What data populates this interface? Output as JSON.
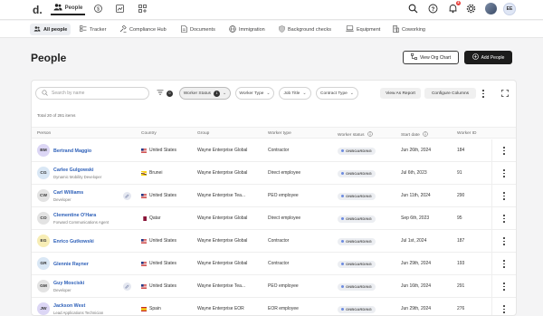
{
  "app": {
    "logo": "d.",
    "nav": [
      {
        "label": "People",
        "icon": "people-icon"
      },
      {
        "label": "",
        "icon": "dollar-icon"
      },
      {
        "label": "",
        "icon": "report-icon"
      },
      {
        "label": "",
        "icon": "grid-icon"
      }
    ],
    "notifications_count": "8",
    "user_initials": "EE"
  },
  "subnav": [
    {
      "label": "All people",
      "icon": "people-icon"
    },
    {
      "label": "Tracker",
      "icon": "tracker-icon"
    },
    {
      "label": "Compliance Hub",
      "icon": "gavel-icon"
    },
    {
      "label": "Documents",
      "icon": "document-icon"
    },
    {
      "label": "Immigration",
      "icon": "globe-icon"
    },
    {
      "label": "Background checks",
      "icon": "shield-icon"
    },
    {
      "label": "Equipment",
      "icon": "laptop-icon"
    },
    {
      "label": "Coworking",
      "icon": "building-icon"
    }
  ],
  "page": {
    "title": "People",
    "view_org_chart": "View Org Chart",
    "add_people": "Add People"
  },
  "toolbar": {
    "search_placeholder": "Search by name",
    "filter_count": "0",
    "filters": [
      {
        "label": "Worker Status",
        "count": "1"
      },
      {
        "label": "Worker Type"
      },
      {
        "label": "Job Title"
      },
      {
        "label": "Contract Type"
      }
    ],
    "view_as_report": "View As Report",
    "configure_columns": "Configure Columns"
  },
  "table": {
    "total_label": "Total 20 of 281 items",
    "columns": [
      "Person",
      "Country",
      "Group",
      "Worker type",
      "Worker status",
      "Start date",
      "Worker ID"
    ],
    "rows": [
      {
        "initials": "BM",
        "avatar_color": "#dcd6f5",
        "name": "Bertrand Maggio",
        "title": "",
        "country": "United States",
        "flag": "us",
        "group": "Wayne Enterprise Global",
        "type": "Contractor",
        "status": "ONBOARDING",
        "start": "Jun 26th, 2024",
        "id": "184",
        "edit": false
      },
      {
        "initials": "CG",
        "avatar_color": "#d9e7f5",
        "name": "Carlee Gulgowski",
        "title": "Dynamic Mobility Developer",
        "country": "Brunei",
        "flag": "bn",
        "group": "Wayne Enterprise Global",
        "type": "Direct employee",
        "status": "ONBOARDING",
        "start": "Jul 6th, 2023",
        "id": "91",
        "edit": false
      },
      {
        "initials": "CW",
        "avatar_color": "#e3e3e3",
        "name": "Carl Williams",
        "title": "Developer",
        "country": "United States",
        "flag": "us",
        "group": "Wayne Enterprise Tea...",
        "type": "PEO employee",
        "status": "ONBOARDING",
        "start": "Jun 11th, 2024",
        "id": "290",
        "edit": true
      },
      {
        "initials": "CO",
        "avatar_color": "#e3e3e3",
        "name": "Clementine O'Hara",
        "title": "Forward Communications Agent",
        "country": "Qatar",
        "flag": "qa",
        "group": "Wayne Enterprise Global",
        "type": "Direct employee",
        "status": "ONBOARDING",
        "start": "Sep 6th, 2023",
        "id": "95",
        "edit": false
      },
      {
        "initials": "EG",
        "avatar_color": "#f7edb5",
        "name": "Enrico Gutkowski",
        "title": "",
        "country": "United States",
        "flag": "us",
        "group": "Wayne Enterprise Global",
        "type": "Contractor",
        "status": "ONBOARDING",
        "start": "Jul 1st, 2024",
        "id": "187",
        "edit": false
      },
      {
        "initials": "GR",
        "avatar_color": "#d9e7f5",
        "name": "Glennie Rayner",
        "title": "",
        "country": "United States",
        "flag": "us",
        "group": "Wayne Enterprise Global",
        "type": "Contractor",
        "status": "ONBOARDING",
        "start": "Jun 29th, 2024",
        "id": "193",
        "edit": false
      },
      {
        "initials": "GM",
        "avatar_color": "#e3e3e3",
        "name": "Guy Mosciski",
        "title": "Developer",
        "country": "United States",
        "flag": "us",
        "group": "Wayne Enterprise Tea...",
        "type": "PEO employee",
        "status": "ONBOARDING",
        "start": "Jun 16th, 2024",
        "id": "291",
        "edit": true
      },
      {
        "initials": "JW",
        "avatar_color": "#dcd6f5",
        "name": "Jackson West",
        "title": "Lead Applications Technician",
        "country": "Spain",
        "flag": "es",
        "group": "Wayne Enterprise EOR",
        "type": "EOR employee",
        "status": "ONBOARDING",
        "start": "Jun 29th, 2024",
        "id": "276",
        "edit": false
      }
    ]
  }
}
